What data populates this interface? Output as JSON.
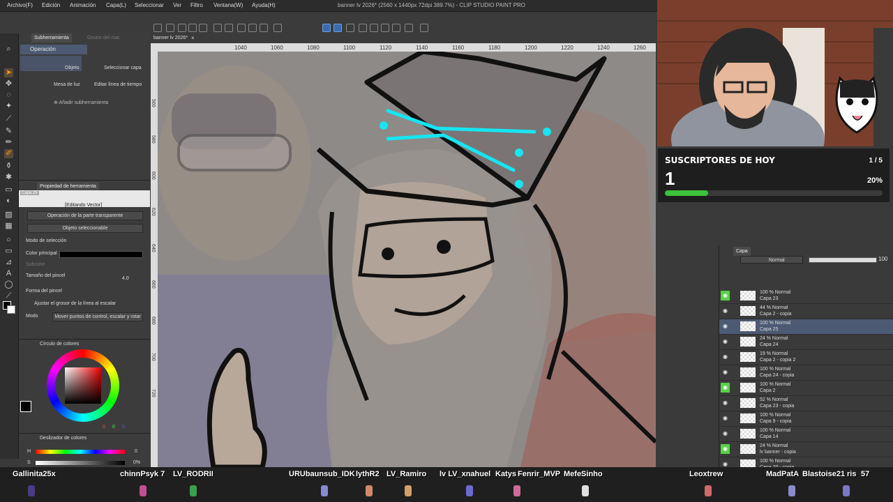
{
  "window": {
    "title": "banner lv 2026* (2560 x 1440px 72dpi 389.7%) - CLIP STUDIO PAINT PRO"
  },
  "menu": [
    "Archivo(F)",
    "Edición",
    "Animación",
    "Capa(L)",
    "Seleccionar",
    "Ver",
    "Filtro",
    "Ventana(W)",
    "Ayuda(H)"
  ],
  "canvas_tab": "banner lv 2026*",
  "ruler": [
    "1040",
    "1060",
    "1080",
    "1100",
    "1120",
    "1140",
    "1160",
    "1180",
    "1200",
    "1220",
    "1240",
    "1260"
  ],
  "vruler": [
    "560",
    "580",
    "600",
    "620",
    "640",
    "660",
    "680",
    "700",
    "720"
  ],
  "subtool": {
    "tab_active": "Subherramienta",
    "tab_inactive": "Gestor del mat.",
    "title": "Operación",
    "items": [
      "Objeto",
      "Seleccionar capa",
      "Mesa de luz",
      "Editar línea de tiempo"
    ],
    "add": "Añadir subherramienta"
  },
  "tool_property": {
    "tab": "Propiedad de herramienta",
    "layer_chip": "Capa 25",
    "editing": "[Editando Vector]",
    "btn1": "Operación de la parte transparente",
    "btn2": "Objeto seleccionable",
    "selection_mode": "Modo de selección",
    "main_color": "Color principal",
    "sub_color": "Subcolor",
    "brush_size": "Tamaño del pincel",
    "brush_size_value": "4.0",
    "brush_shape": "Forma del pincel",
    "adjust_width": "Ajustar el grosor de la línea al escalar",
    "mode": "Modo",
    "mode_value": "Mover puntos de control, escalar y rotar"
  },
  "color_panel": {
    "title": "Círculo de colores",
    "r": "0",
    "g": "0",
    "b": "0"
  },
  "slider_panel": {
    "title": "Deslizador de colores",
    "h": "H",
    "s": "S",
    "h_val": "0",
    "s_val": "0%"
  },
  "subs_widget": {
    "title": "SUSCRIPTORES DE HOY",
    "count": "1",
    "goal": "1 / 5",
    "percent": "20%",
    "progress": 0.2
  },
  "layer_panel": {
    "tab": "Capa",
    "blend": "Normal",
    "opacity": "100",
    "layers": [
      {
        "mode": "100 % Normal",
        "name": "Capa 23",
        "green": true,
        "selected": false
      },
      {
        "mode": "44 % Normal",
        "name": "Capa 2 - copia",
        "green": false,
        "selected": false
      },
      {
        "mode": "100 % Normal",
        "name": "Capa 25",
        "green": false,
        "selected": true
      },
      {
        "mode": "24 % Normal",
        "name": "Capa 24",
        "green": false,
        "selected": false
      },
      {
        "mode": "19 % Normal",
        "name": "Capa 2 - copia 2",
        "green": false,
        "selected": false
      },
      {
        "mode": "100 % Normal",
        "name": "Capa 24 - copia",
        "green": false,
        "selected": false
      },
      {
        "mode": "100 % Normal",
        "name": "Capa 2",
        "green": true,
        "selected": false
      },
      {
        "mode": "52 % Normal",
        "name": "Capa 23 - copia",
        "green": false,
        "selected": false
      },
      {
        "mode": "100 % Normal",
        "name": "Capa 9 - copia",
        "green": false,
        "selected": false
      },
      {
        "mode": "100 % Normal",
        "name": "Capa 14",
        "green": false,
        "selected": false
      },
      {
        "mode": "24 % Normal",
        "name": "lv banner - copia",
        "green": true,
        "selected": false
      },
      {
        "mode": "100 % Normal",
        "name": "Capa 20 - copia",
        "green": false,
        "selected": false
      }
    ]
  },
  "viewers": [
    "Gallinita25x",
    "chinnPsyk 7",
    "LV_RODRII",
    "URUbaunsub_IDK",
    "lythR2",
    "LV_Ramiro",
    "lv LV_xnahuel",
    "Katys",
    "Fenrir_MVP",
    "MefeSinho",
    "Leoxtrew",
    "MadPatA",
    "Blastoise21",
    "ris",
    "57"
  ]
}
